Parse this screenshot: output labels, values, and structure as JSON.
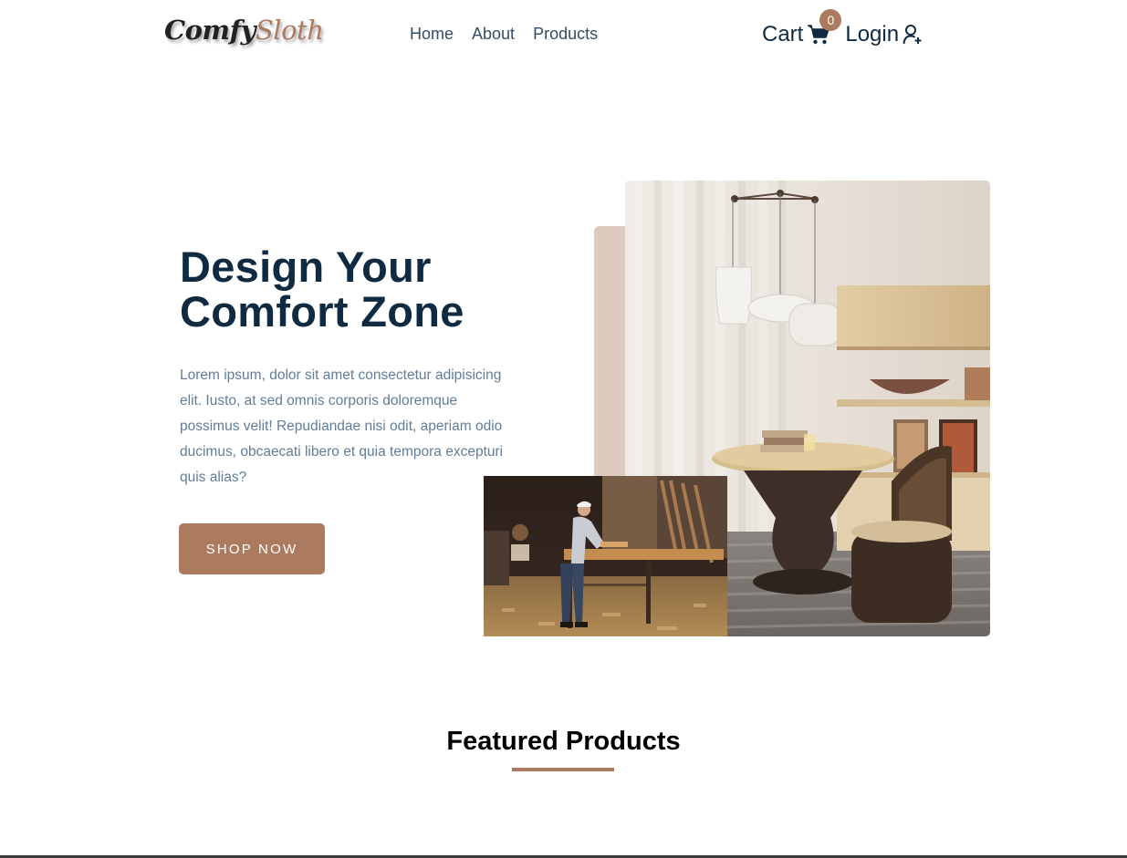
{
  "navbar": {
    "logo": {
      "part1": "Comfy",
      "part2": "Sloth"
    },
    "links": [
      "Home",
      "About",
      "Products"
    ],
    "cart": {
      "label": "Cart",
      "count": "0",
      "icon": "cart-icon"
    },
    "login": {
      "label": "Login",
      "icon": "user-plus-icon"
    }
  },
  "hero": {
    "title_line1": "Design Your",
    "title_line2": "Comfort Zone",
    "text": "Lorem ipsum, dolor sit amet consectetur adipisicing elit. Iusto, at sed omnis corporis doloremque possimus velit! Repudiandae nisi odit, aperiam odio ducimus, obcaecati libero et quia tempora excepturi quis alias?",
    "button_label": "SHOP NOW"
  },
  "featured": {
    "title": "Featured Products"
  },
  "colors": {
    "primary": "#ab7a5f",
    "primary_light": "#decbc0",
    "heading": "#102a42",
    "nav_text": "#324d67",
    "body_text": "#617d98"
  }
}
